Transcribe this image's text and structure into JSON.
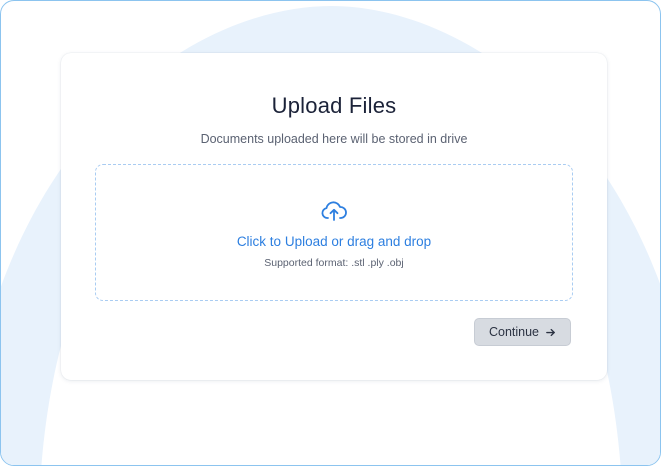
{
  "upload": {
    "title": "Upload Files",
    "subtitle": "Documents uploaded here will be stored in drive",
    "dropzone": {
      "label": "Click to Upload or drag and drop",
      "formats": "Supported format: .stl .ply .obj",
      "icon": "cloud-upload-icon"
    },
    "continue_label": "Continue",
    "continue_icon": "arrow-right-icon"
  },
  "colors": {
    "accent": "#2d7fe0",
    "frame_border": "#8cc4ef",
    "background_arc": "#e8f2fc",
    "button_bg": "#d7dbe1",
    "title_text": "#1b2238"
  }
}
